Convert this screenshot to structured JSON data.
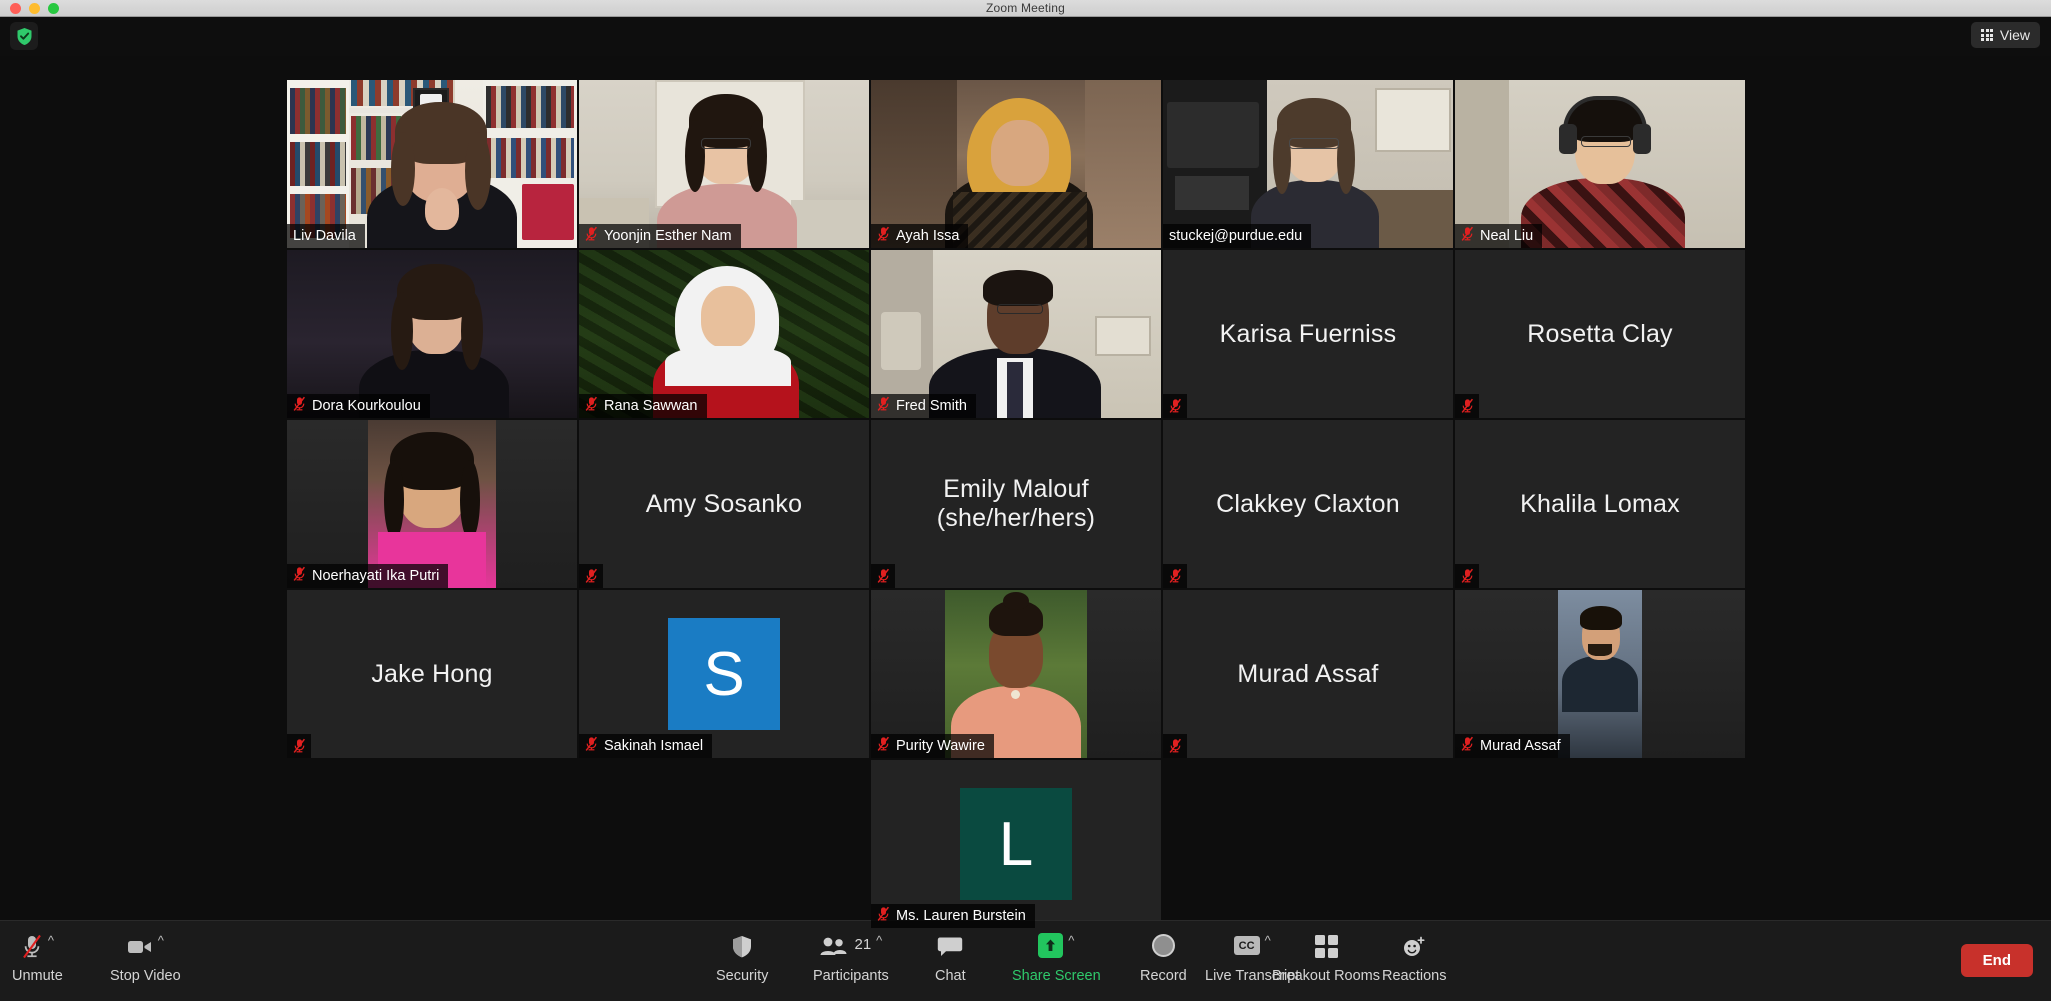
{
  "window": {
    "title": "Zoom Meeting",
    "traffic_lights": [
      "close",
      "minimize",
      "maximize"
    ]
  },
  "topbar": {
    "security_shield_icon": "shield-check-icon",
    "view_button": {
      "label": "View",
      "icon": "grid-icon"
    }
  },
  "gallery": {
    "columns": 5,
    "participants": [
      {
        "name": "Liv Davila",
        "video": true,
        "muted": false,
        "speaking": true,
        "kind": "video",
        "scene": "bookshelf"
      },
      {
        "name": "Yoonjin Esther Nam",
        "video": true,
        "muted": true,
        "speaking": false,
        "kind": "video",
        "scene": "room-door"
      },
      {
        "name": "Ayah Issa",
        "video": true,
        "muted": true,
        "speaking": false,
        "kind": "video",
        "scene": "hijab-room"
      },
      {
        "name": "stuckej@purdue.edu",
        "video": true,
        "muted": false,
        "speaking": false,
        "kind": "video",
        "scene": "office"
      },
      {
        "name": "Neal Liu",
        "video": true,
        "muted": true,
        "speaking": false,
        "kind": "video",
        "scene": "headphones"
      },
      {
        "name": "Dora Kourkoulou",
        "video": true,
        "muted": true,
        "speaking": false,
        "kind": "video",
        "scene": "dark-room"
      },
      {
        "name": "Rana Sawwan",
        "video": true,
        "muted": true,
        "speaking": false,
        "kind": "video",
        "scene": "red-tree"
      },
      {
        "name": "Fred Smith",
        "video": true,
        "muted": true,
        "speaking": false,
        "kind": "video",
        "scene": "suit-room"
      },
      {
        "name": "Karisa Fuerniss",
        "video": false,
        "muted": true,
        "speaking": false,
        "kind": "name"
      },
      {
        "name": "Rosetta Clay",
        "video": false,
        "muted": true,
        "speaking": false,
        "kind": "name"
      },
      {
        "name": "Noerhayati Ika Putri",
        "video": false,
        "muted": true,
        "speaking": false,
        "kind": "photo",
        "scene": "pink-portrait"
      },
      {
        "name": "Amy Sosanko",
        "video": false,
        "muted": true,
        "speaking": false,
        "kind": "name"
      },
      {
        "name": "Emily Malouf (she/her/hers)",
        "video": false,
        "muted": true,
        "speaking": false,
        "kind": "name"
      },
      {
        "name": "Clakkey Claxton",
        "video": false,
        "muted": true,
        "speaking": false,
        "kind": "name"
      },
      {
        "name": "Khalila Lomax",
        "video": false,
        "muted": true,
        "speaking": false,
        "kind": "name"
      },
      {
        "name": "Jake Hong",
        "video": false,
        "muted": true,
        "speaking": false,
        "kind": "name"
      },
      {
        "name": "Sakinah Ismael",
        "video": false,
        "muted": true,
        "speaking": false,
        "kind": "avatar",
        "avatar_letter": "S",
        "avatar_color": "#1a7cc4"
      },
      {
        "name": "Purity Wawire",
        "video": false,
        "muted": true,
        "speaking": false,
        "kind": "photo",
        "scene": "green-outdoor"
      },
      {
        "name": "Murad Assaf",
        "video": false,
        "muted": true,
        "speaking": false,
        "kind": "name"
      },
      {
        "name": "Murad Assaf",
        "video": false,
        "muted": true,
        "speaking": false,
        "kind": "photo",
        "scene": "man-portrait"
      },
      {
        "name": "Ms. Lauren Burstein",
        "video": false,
        "muted": true,
        "speaking": false,
        "kind": "avatar",
        "avatar_letter": "L",
        "avatar_color": "#0a4a40"
      }
    ]
  },
  "toolbar": {
    "mute": {
      "label": "Unmute",
      "icon": "microphone-muted-icon",
      "has_caret": true
    },
    "video": {
      "label": "Stop Video",
      "icon": "video-camera-icon",
      "has_caret": true
    },
    "security": {
      "label": "Security",
      "icon": "shield-icon",
      "has_caret": false
    },
    "participants": {
      "label": "Participants",
      "icon": "people-icon",
      "count": "21",
      "has_caret": true
    },
    "chat": {
      "label": "Chat",
      "icon": "chat-bubble-icon",
      "has_caret": false
    },
    "share_screen": {
      "label": "Share Screen",
      "icon": "share-arrow-up-icon",
      "has_caret": true
    },
    "record": {
      "label": "Record",
      "icon": "record-circle-icon",
      "has_caret": false
    },
    "live_transcript": {
      "label": "Live Transcript",
      "icon": "closed-caption-icon",
      "badge": "CC",
      "has_caret": true
    },
    "breakout_rooms": {
      "label": "Breakout Rooms",
      "icon": "grid-squares-icon",
      "has_caret": false
    },
    "reactions": {
      "label": "Reactions",
      "icon": "smiley-plus-icon",
      "has_caret": false
    },
    "end": {
      "label": "End"
    }
  },
  "colors": {
    "accent_green": "#2fc96b",
    "end_red": "#c8312b",
    "speaking_border": "#c6e26b",
    "mute_red": "#e02020"
  }
}
